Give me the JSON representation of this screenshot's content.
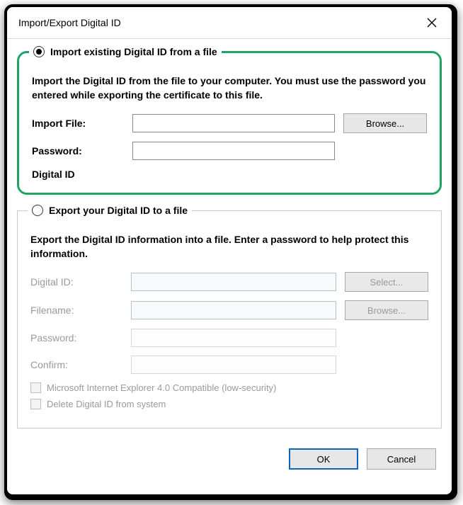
{
  "title": "Import/Export Digital ID",
  "import": {
    "radio_label": "Import existing Digital ID from a file",
    "description": "Import the Digital ID from the file to your computer. You must use the password you entered while exporting the certificate to this file.",
    "file_label": "Import File:",
    "file_value": "",
    "browse": "Browse...",
    "password_label": "Password:",
    "password_value": "",
    "digital_id_label": "Digital ID"
  },
  "export": {
    "radio_label": "Export your Digital ID to a file",
    "description": "Export the Digital ID information into a file. Enter a password to help protect this information.",
    "digital_id_label": "Digital ID:",
    "select": "Select...",
    "filename_label": "Filename:",
    "browse": "Browse...",
    "password_label": "Password:",
    "confirm_label": "Confirm:",
    "compat_label": "Microsoft Internet Explorer 4.0 Compatible (low-security)",
    "delete_label": "Delete Digital ID from system"
  },
  "buttons": {
    "ok": "OK",
    "cancel": "Cancel"
  }
}
